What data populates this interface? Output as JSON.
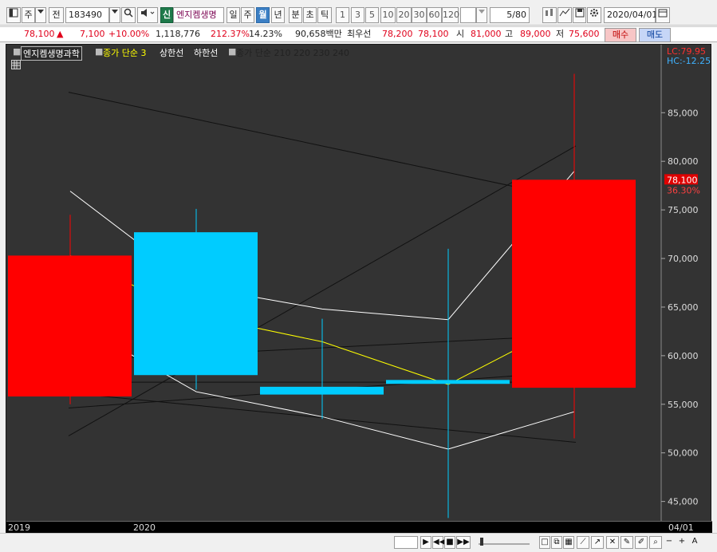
{
  "toolbar": {
    "period_label": "주",
    "all_label": "전",
    "code_value": "183490",
    "sin_badge": "신",
    "stock_name": "엔지켐생명",
    "period_buttons": [
      "일",
      "주",
      "월",
      "년",
      "분",
      "초",
      "틱"
    ],
    "active_period": "월",
    "count_buttons": [
      "1",
      "3",
      "5",
      "10",
      "20",
      "30",
      "60",
      "120"
    ],
    "page_value": "5",
    "page_total": "/80",
    "date_value": "2020/04/01"
  },
  "info": {
    "price": "78,100",
    "change": "7,100",
    "change_pct": "+10.00%",
    "volume": "1,118,776",
    "vol_ratio": "212.37%",
    "turnover": "14.23%",
    "amount": "90,658백만",
    "ask_label": "최우선",
    "ask": "78,200",
    "bid": "78,100",
    "open_label": "시",
    "open": "81,000",
    "high_label": "고",
    "high": "89,000",
    "low_label": "저",
    "low": "75,600",
    "buy_label": "매수",
    "sell_label": "매도"
  },
  "legend": {
    "stock": "엔지켐생명과학",
    "ma_label": "종가 단순 3",
    "upper_label": "상한선",
    "lower_label": "하한선",
    "ma2_label": "종가 단순 210  220  230  240"
  },
  "chart_data": {
    "type": "candlestick",
    "x": [
      "2019/12",
      "2020/01",
      "2020/02",
      "2020/03",
      "2020/04"
    ],
    "candles": [
      {
        "x": "2019/12",
        "open": 55800,
        "high": 74500,
        "low": 55000,
        "close": 70300
      },
      {
        "x": "2020/01",
        "open": 72700,
        "high": 75100,
        "low": 56500,
        "close": 58000
      },
      {
        "x": "2020/02",
        "open": 56800,
        "high": 63800,
        "low": 53500,
        "close": 56000
      },
      {
        "x": "2020/03",
        "open": 57500,
        "high": 71000,
        "low": 43300,
        "close": 57100
      },
      {
        "x": "2020/04",
        "open": 56700,
        "high": 89000,
        "low": 51500,
        "close": 78100
      }
    ],
    "ylim": [
      43000,
      92000
    ],
    "yticks": [
      45000,
      50000,
      55000,
      60000,
      65000,
      70000,
      75000,
      80000,
      85000
    ],
    "ytick_labels": [
      "45,000",
      "50,000",
      "55,000",
      "60,000",
      "65,000",
      "70,000",
      "75,000",
      "80,000",
      "85,000"
    ],
    "x_labels": [
      "2019",
      "2020"
    ],
    "right_x_label": "04/01",
    "current_price_label": "78,100",
    "current_pct_label": "36.30%",
    "lc_label": "LC:79.95",
    "hc_label": "HC:-12.25",
    "colors": {
      "bull": "#ff0000",
      "bear": "#00ccff",
      "ma": "#ffff00",
      "band": "#ffffff",
      "long_ma": "#111111",
      "background": "#333333"
    }
  },
  "scroll": {
    "zoom_label": "A"
  }
}
